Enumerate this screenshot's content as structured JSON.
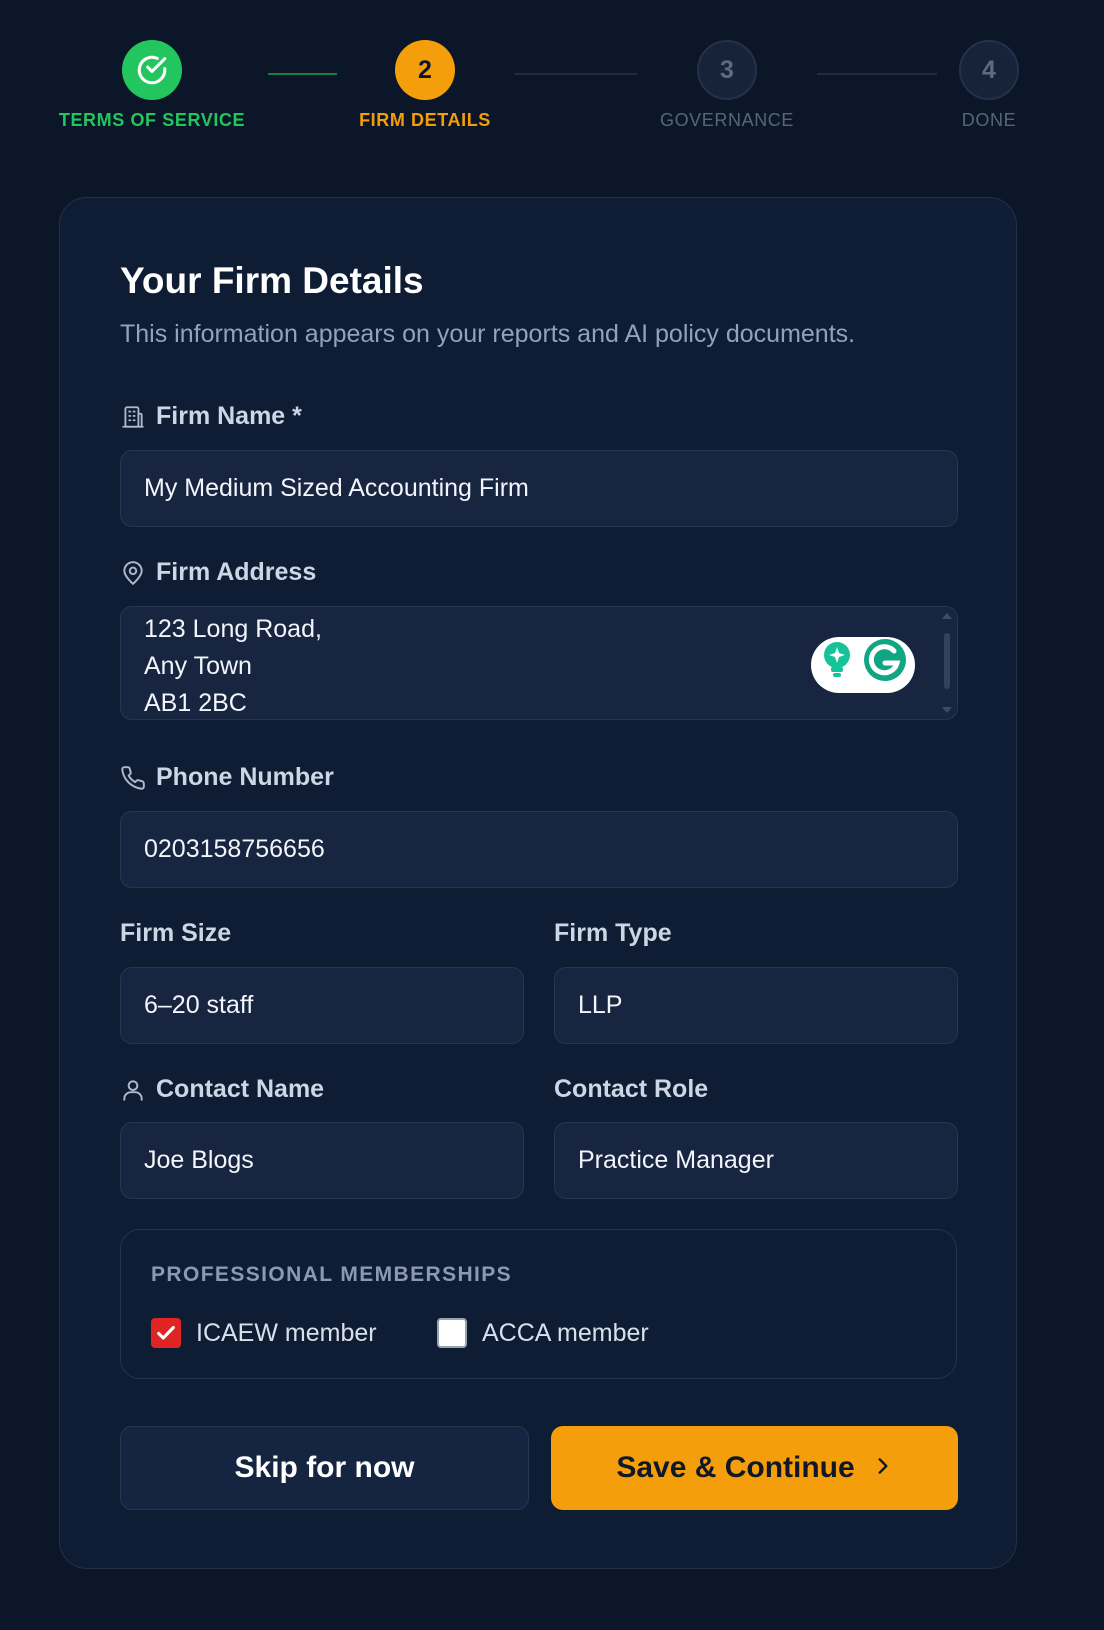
{
  "stepper": {
    "steps": [
      {
        "number": "",
        "label": "TERMS OF SERVICE",
        "state": "done",
        "icon": "check-circle-icon"
      },
      {
        "number": "2",
        "label": "FIRM DETAILS",
        "state": "current"
      },
      {
        "number": "3",
        "label": "GOVERNANCE",
        "state": "pending"
      },
      {
        "number": "4",
        "label": "DONE",
        "state": "pending"
      }
    ]
  },
  "card": {
    "title": "Your Firm Details",
    "subtitle": "This information appears on your reports and AI policy documents."
  },
  "fields": {
    "firm_name": {
      "label": "Firm Name *",
      "value": "My Medium Sized Accounting Firm",
      "icon": "building-icon"
    },
    "firm_address": {
      "label": "Firm Address",
      "lines": [
        "123 Long Road,",
        "Any Town",
        "AB1 2BC"
      ],
      "icon": "map-pin-icon"
    },
    "phone": {
      "label": "Phone Number",
      "value": "0203158756656",
      "icon": "phone-icon"
    },
    "firm_size": {
      "label": "Firm Size",
      "value": "6–20 staff"
    },
    "firm_type": {
      "label": "Firm Type",
      "value": "LLP"
    },
    "contact_name": {
      "label": "Contact Name",
      "value": "Joe Blogs",
      "icon": "user-icon"
    },
    "contact_role": {
      "label": "Contact Role",
      "value": "Practice Manager"
    }
  },
  "memberships": {
    "title": "PROFESSIONAL MEMBERSHIPS",
    "options": [
      {
        "label": "ICAEW member",
        "checked": true
      },
      {
        "label": "ACCA member",
        "checked": false
      }
    ]
  },
  "actions": {
    "skip_label": "Skip for now",
    "save_label": "Save & Continue"
  },
  "colors": {
    "background": "#0b1628",
    "card": "#0f1d34",
    "accent": "#f59e0b",
    "success": "#22c55e",
    "checkbox_checked": "#e02424"
  }
}
